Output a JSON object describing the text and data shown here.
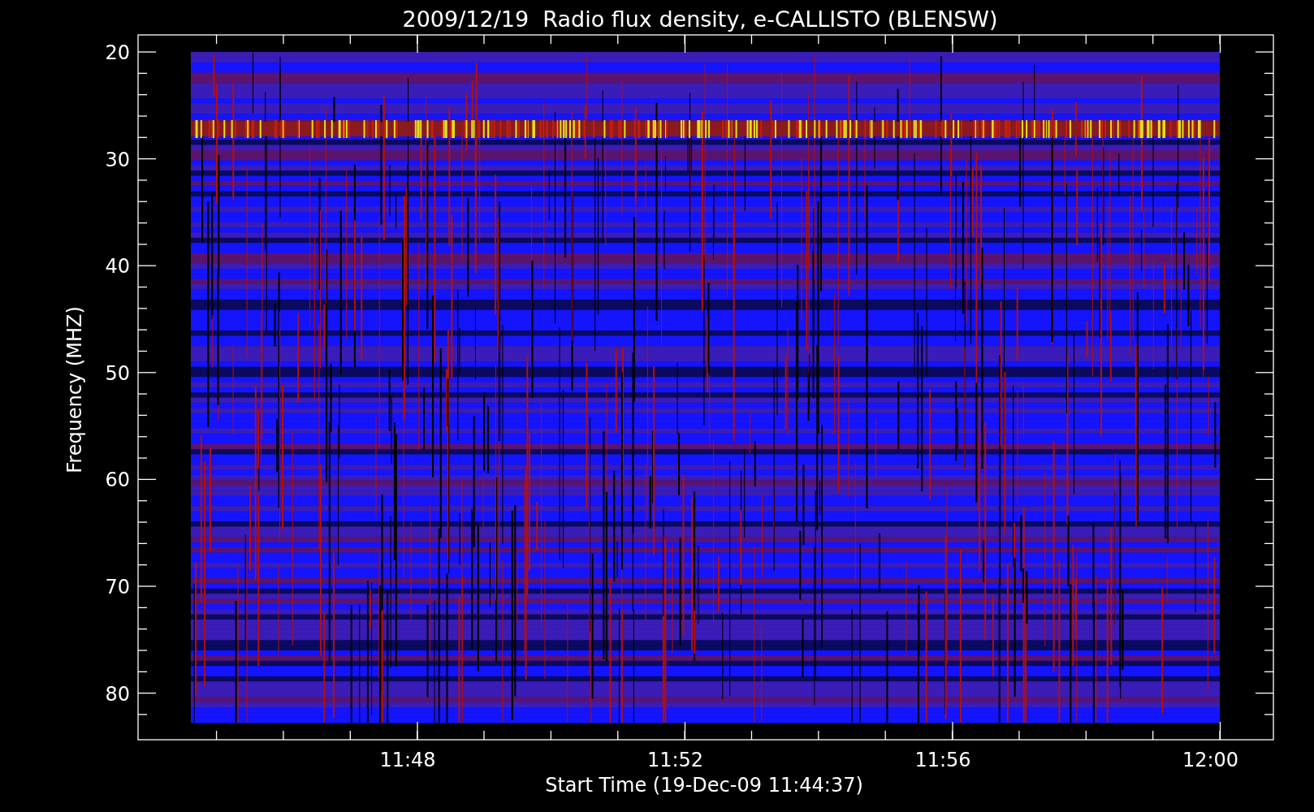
{
  "title": "2009/12/19  Radio flux density, e-CALLISTO (BLENSW)",
  "y_axis": {
    "label": "Frequency (MHZ)",
    "ticks": [
      "20",
      "30",
      "40",
      "50",
      "60",
      "70",
      "80"
    ]
  },
  "x_axis": {
    "label": "Start Time (19-Dec-09 11:44:37)",
    "ticks": [
      "11:48",
      "11:52",
      "11:56",
      "12:00"
    ]
  }
}
